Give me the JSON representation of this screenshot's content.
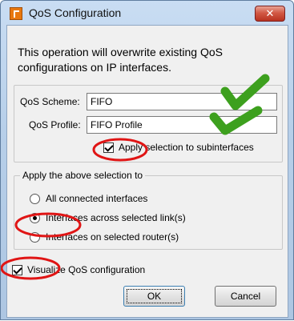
{
  "window": {
    "title": "QoS Configuration",
    "close_glyph": "✕",
    "icon": "app-logo-icon"
  },
  "message": "This operation will overwrite existing QoS configurations on IP interfaces.",
  "qos": {
    "scheme_label": "QoS Scheme:",
    "scheme_value": "FIFO",
    "profile_label": "QoS Profile:",
    "profile_value": "FIFO Profile",
    "apply_sub": {
      "label": "Apply selection to subinterfaces",
      "checked": true
    }
  },
  "apply_group": {
    "legend": "Apply the above selection to",
    "options": [
      {
        "label": "All connected interfaces",
        "selected": false
      },
      {
        "label": "Interfaces across selected link(s)",
        "selected": true
      },
      {
        "label": "Interfaces on selected router(s)",
        "selected": false
      }
    ]
  },
  "visualize": {
    "label": "Visualize QoS configuration",
    "checked": true
  },
  "buttons": {
    "ok": "OK",
    "cancel": "Cancel"
  },
  "annotations": {
    "check_color": "#3da01e",
    "circle_color": "#e01515"
  }
}
